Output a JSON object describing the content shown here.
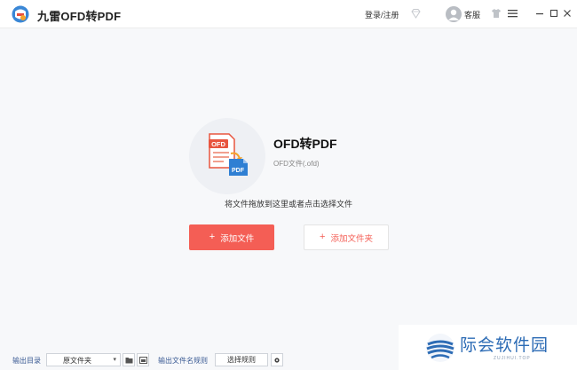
{
  "titlebar": {
    "app_title": "九雷OFD转PDF",
    "login_label": "登录/注册",
    "service_label": "客服",
    "icons": [
      "app-logo-icon",
      "diamond-icon",
      "avatar-icon",
      "shirt-icon",
      "menu-icon",
      "minimize-icon",
      "maximize-icon",
      "close-icon"
    ]
  },
  "main": {
    "conversion_title": "OFD转PDF",
    "conversion_subtitle": "OFD文件(.ofd)",
    "drop_hint": "将文件拖放到这里或者点击选择文件",
    "add_file_label": "添加文件",
    "add_folder_label": "添加文件夹",
    "plus": "+",
    "doc_icon_text_top": "OFD",
    "doc_icon_text_bottom": "PDF"
  },
  "bottom": {
    "output_dir_label": "输出目录",
    "output_dir_value": "原文件夹",
    "name_rule_label": "输出文件名规则",
    "choose_rule_label": "选择规则"
  },
  "watermark": {
    "text": "际会软件园",
    "sub": "ZUJIHUI.TOP"
  },
  "colors": {
    "accent": "#f45e55",
    "label_blue": "#3b5b94",
    "background": "#f7f8fa"
  }
}
